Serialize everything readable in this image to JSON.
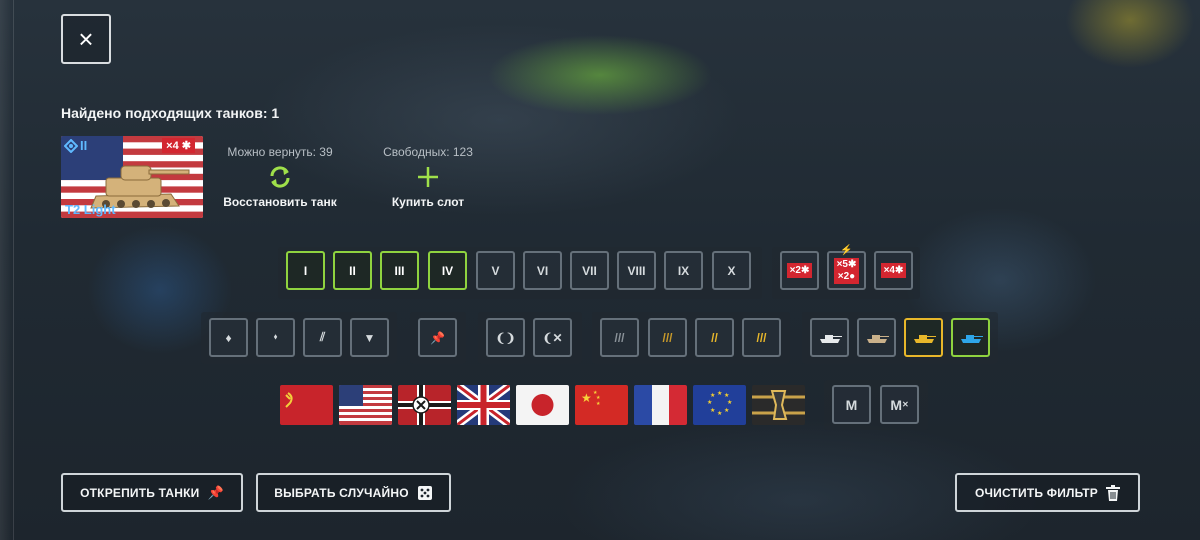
{
  "close_label": "×",
  "found_text": "Найдено подходящих танков: 1",
  "tank": {
    "name": "T2 Light",
    "tier": "II",
    "multiplier": "×4"
  },
  "restore": {
    "caption": "Можно вернуть: 39",
    "label": "Восстановить танк"
  },
  "slot": {
    "caption": "Свободных: 123",
    "label": "Купить слот"
  },
  "tiers": [
    "I",
    "II",
    "III",
    "IV",
    "V",
    "VI",
    "VII",
    "VIII",
    "IX",
    "X"
  ],
  "tiers_selected": [
    "I",
    "II",
    "III",
    "IV"
  ],
  "multipliers": {
    "x2": "×2",
    "x5": "×5",
    "x2b": "×2",
    "x4": "×4"
  },
  "classes_selected": [
    "medium-tank",
    "light-tank"
  ],
  "nations": [
    "ussr",
    "usa",
    "germany",
    "uk",
    "japan",
    "china",
    "france",
    "europe",
    "other"
  ],
  "mastery_labels": [
    "M",
    "M"
  ],
  "bottom": {
    "unpin": "ОТКРЕПИТЬ ТАНКИ",
    "random": "ВЫБРАТЬ СЛУЧАЙНО",
    "clear": "ОЧИСТИТЬ ФИЛЬТР"
  },
  "colors": {
    "accent_green": "#8fd33f",
    "tier_blue": "#5fb9ff",
    "badge_red": "#d32630",
    "yellow": "#e8b72a",
    "blue": "#2ea6e8"
  }
}
